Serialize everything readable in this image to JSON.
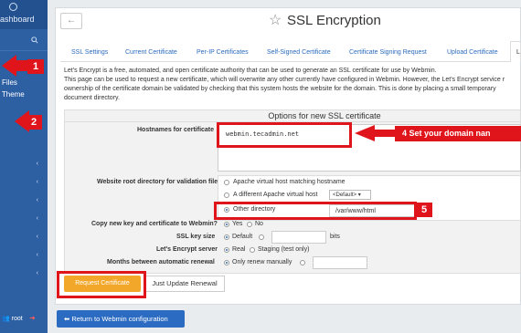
{
  "sidebar": {
    "dashboard_label": "ashboard",
    "items": [
      {
        "label": "Files"
      },
      {
        "label": "l Theme"
      }
    ],
    "root_label": "root"
  },
  "header": {
    "title": "SSL Encryption"
  },
  "tabs": [
    {
      "label": "SSL Settings"
    },
    {
      "label": "Current Certificate"
    },
    {
      "label": "Per-IP Certificates"
    },
    {
      "label": "Self-Signed Certificate"
    },
    {
      "label": "Certificate Signing Request"
    },
    {
      "label": "Upload Certificate"
    },
    {
      "label": "L"
    }
  ],
  "description": [
    "Let's Encrypt is a free, automated, and open certificate authority that can be used to generate an SSL certificate for use by Webmin.",
    "This page can be used to request a new certificate, which will overwrite any other currently have configured in Webmin. However, the Let's Encrypt service r",
    "ownership of the certificate domain be validated by checking that this system hosts the website for the domain. This is done by placing a small temporary",
    "document directory."
  ],
  "options": {
    "heading": "Options for new SSL certificate",
    "hostnames_label": "Hostnames for certificate",
    "hostnames_value": "webmin.tecadmin.net",
    "webroot_label": "Website root directory for validation file",
    "webroot_options": [
      "Apache virtual host matching hostname",
      "A different Apache virtual host",
      "Other directory"
    ],
    "vhost_select": "<Default>",
    "other_dir_value": "/var/www/html",
    "copy_label": "Copy new key and certificate to Webmin?",
    "copy_yes": "Yes",
    "copy_no": "No",
    "keysize_label": "SSL key size",
    "keysize_default": "Default",
    "keysize_unit": "bits",
    "server_label": "Let's Encrypt server",
    "server_real": "Real",
    "server_staging": "Staging (test only)",
    "renew_label": "Months between automatic renewal",
    "renew_manual": "Only renew manually"
  },
  "buttons": {
    "request": "Request Certificate",
    "update": "Just Update Renewal",
    "return": "Return to Webmin configuration"
  },
  "annotations": {
    "step1": "1",
    "step2": "2",
    "step4": "4 Set your domain nan",
    "step5": "5"
  },
  "colors": {
    "sidebar": "#2d5fa3",
    "accent_red": "#e0141b",
    "request_button": "#f3a72a",
    "return_button": "#2c6bc2"
  }
}
